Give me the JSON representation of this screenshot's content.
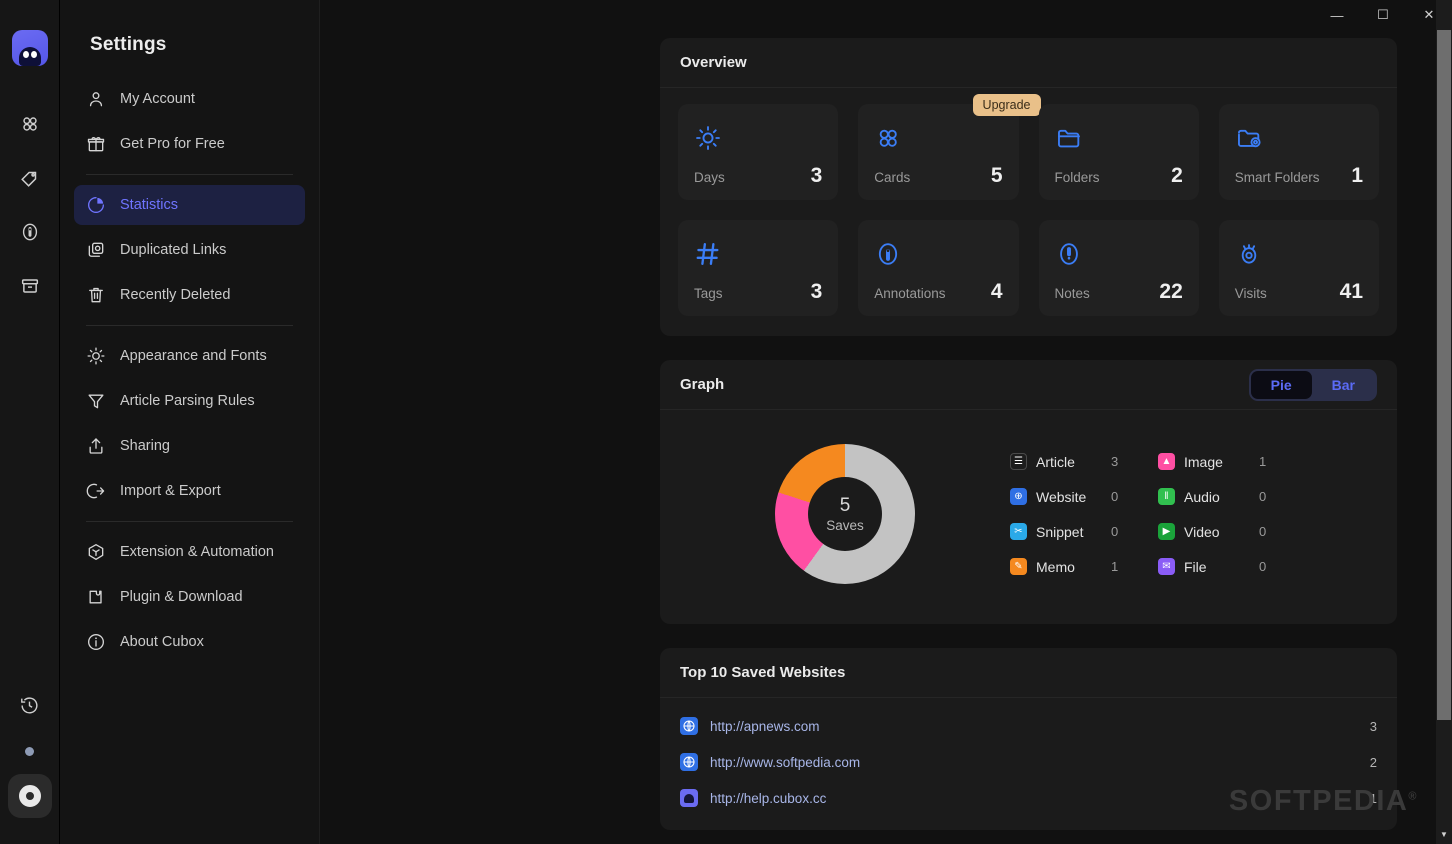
{
  "window": {
    "minimize_label": "—",
    "maximize_label": "☐",
    "close_label": "✕"
  },
  "rail": {
    "logo_name": "cubox-logo",
    "items": [
      {
        "name": "inbox-grid-icon",
        "glyph": "grid"
      },
      {
        "name": "tag-icon",
        "glyph": "tag"
      },
      {
        "name": "annotation-icon",
        "glyph": "annotation"
      },
      {
        "name": "archive-icon",
        "glyph": "archive"
      }
    ],
    "history_icon": "history-icon",
    "settings_icon": "settings-active-icon"
  },
  "sidebar": {
    "title": "Settings",
    "groups": [
      {
        "items": [
          {
            "label": "My Account",
            "icon": "user-icon",
            "active": false
          },
          {
            "label": "Get Pro for Free",
            "icon": "gift-icon",
            "active": false
          }
        ]
      },
      {
        "items": [
          {
            "label": "Statistics",
            "icon": "pie-chart-icon",
            "active": true
          },
          {
            "label": "Duplicated Links",
            "icon": "duplicate-icon",
            "active": false
          },
          {
            "label": "Recently Deleted",
            "icon": "trash-icon",
            "active": false
          }
        ]
      },
      {
        "items": [
          {
            "label": "Appearance and Fonts",
            "icon": "sun-icon",
            "active": false
          },
          {
            "label": "Article Parsing Rules",
            "icon": "filter-icon",
            "active": false
          },
          {
            "label": "Sharing",
            "icon": "share-icon",
            "active": false
          },
          {
            "label": "Import & Export",
            "icon": "import-export-icon",
            "active": false
          }
        ]
      },
      {
        "items": [
          {
            "label": "Extension & Automation",
            "icon": "cube-icon",
            "active": false
          },
          {
            "label": "Plugin & Download",
            "icon": "plugin-icon",
            "active": false
          },
          {
            "label": "About Cubox",
            "icon": "info-icon",
            "active": false
          }
        ]
      }
    ]
  },
  "overview": {
    "title": "Overview",
    "cards": [
      {
        "label": "Days",
        "value": "3",
        "icon": "sun-icon",
        "badge": null
      },
      {
        "label": "Cards",
        "value": "5",
        "icon": "cards-icon",
        "badge": "Upgrade"
      },
      {
        "label": "Folders",
        "value": "2",
        "icon": "folder-icon",
        "badge": null
      },
      {
        "label": "Smart Folders",
        "value": "1",
        "icon": "smart-folder-icon",
        "badge": null
      },
      {
        "label": "Tags",
        "value": "3",
        "icon": "hash-icon",
        "badge": null
      },
      {
        "label": "Annotations",
        "value": "4",
        "icon": "annotation-icon",
        "badge": null
      },
      {
        "label": "Notes",
        "value": "22",
        "icon": "note-icon",
        "badge": null
      },
      {
        "label": "Visits",
        "value": "41",
        "icon": "eye-icon",
        "badge": null
      }
    ]
  },
  "graph": {
    "title": "Graph",
    "toggle": {
      "options": [
        "Pie",
        "Bar"
      ],
      "selected": "Pie"
    },
    "center_value": "5",
    "center_label": "Saves"
  },
  "chart_data": {
    "type": "pie",
    "title": "Graph",
    "total": 5,
    "total_label": "Saves",
    "categories": [
      "Article",
      "Website",
      "Snippet",
      "Memo",
      "Image",
      "Audio",
      "Video",
      "File"
    ],
    "values": [
      3,
      0,
      0,
      1,
      1,
      0,
      0,
      0
    ],
    "colors": [
      "#c3c3c3",
      "#2f6fe4",
      "#2aa9e8",
      "#f5891f",
      "#ff4fa3",
      "#31c04f",
      "#1aa33a",
      "#8a5cf6"
    ],
    "slices": [
      {
        "label": "Article",
        "value": 3,
        "percent": 60,
        "color": "#c3c3c3"
      },
      {
        "label": "Image",
        "value": 1,
        "percent": 20,
        "color": "#ff4fa3"
      },
      {
        "label": "Memo",
        "value": 1,
        "percent": 20,
        "color": "#f5891f"
      }
    ],
    "legend_position": "right",
    "legend": [
      {
        "label": "Article",
        "value": "3",
        "color": "#1c1c1c",
        "glyph": "☰"
      },
      {
        "label": "Image",
        "value": "1",
        "color": "#ff4fa3",
        "glyph": "▲"
      },
      {
        "label": "Website",
        "value": "0",
        "color": "#2f6fe4",
        "glyph": "⊕"
      },
      {
        "label": "Audio",
        "value": "0",
        "color": "#31c04f",
        "glyph": "‖"
      },
      {
        "label": "Snippet",
        "value": "0",
        "color": "#2aa9e8",
        "glyph": "✂"
      },
      {
        "label": "Video",
        "value": "0",
        "color": "#1aa33a",
        "glyph": "▶"
      },
      {
        "label": "Memo",
        "value": "1",
        "color": "#f5891f",
        "glyph": "✎"
      },
      {
        "label": "File",
        "value": "0",
        "color": "#8a5cf6",
        "glyph": "✉"
      }
    ]
  },
  "top_sites": {
    "title": "Top 10 Saved Websites",
    "rows": [
      {
        "url": "http://apnews.com",
        "count": "3",
        "icon": "globe-icon"
      },
      {
        "url": "http://www.softpedia.com",
        "count": "2",
        "icon": "globe-icon"
      },
      {
        "url": "http://help.cubox.cc",
        "count": "1",
        "icon": "cubox-favicon"
      }
    ]
  },
  "watermark": {
    "text": "SOFTPEDIA",
    "mark": "®"
  },
  "colors": {
    "accent_blue": "#3b7df5",
    "active_nav_bg": "#1d2142",
    "active_nav_text": "#6f74ff",
    "badge_bg": "#e9c089",
    "panel_bg": "#1b1b1b",
    "card_bg": "#212121"
  }
}
